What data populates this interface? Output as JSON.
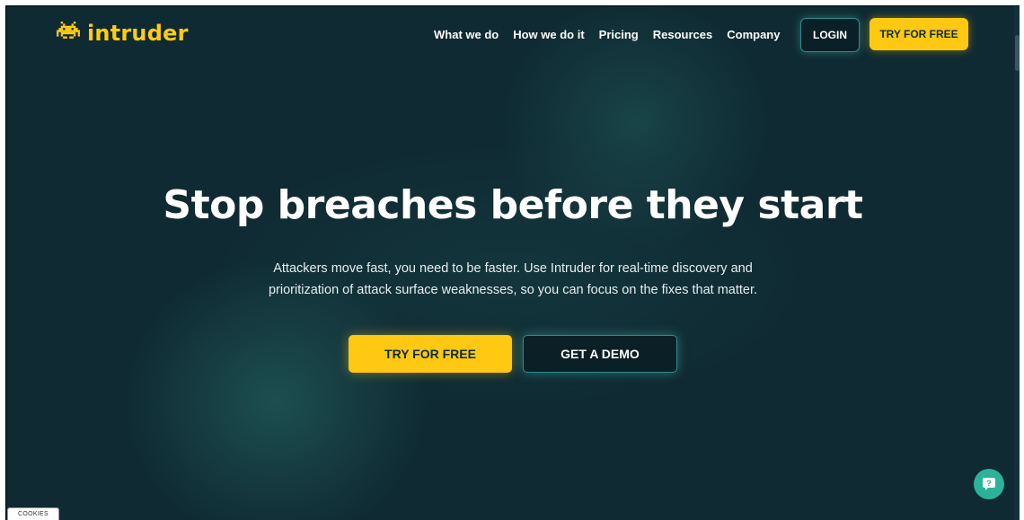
{
  "header": {
    "logo_text": "intruder",
    "logo_icon": "space-invader-icon",
    "nav": [
      "What we do",
      "How we do it",
      "Pricing",
      "Resources",
      "Company"
    ],
    "login_label": "LOGIN",
    "try_label": "TRY FOR FREE"
  },
  "hero": {
    "title": "Stop breaches before they start",
    "subtitle_line1": "Attackers move fast, you need to be faster. Use Intruder for real-time discovery and",
    "subtitle_line2": "prioritization of attack surface weaknesses, so you can focus on the fixes that matter.",
    "primary_cta": "TRY FOR FREE",
    "secondary_cta": "GET A DEMO"
  },
  "widgets": {
    "chat_icon": "help-chat-icon",
    "chat_glyph": "?",
    "cookies_label": "COOKIES"
  },
  "colors": {
    "background": "#0f2a32",
    "accent_yellow": "#ffc812",
    "teal_glow": "#2f8a8a",
    "chat_green": "#2bb39a"
  }
}
